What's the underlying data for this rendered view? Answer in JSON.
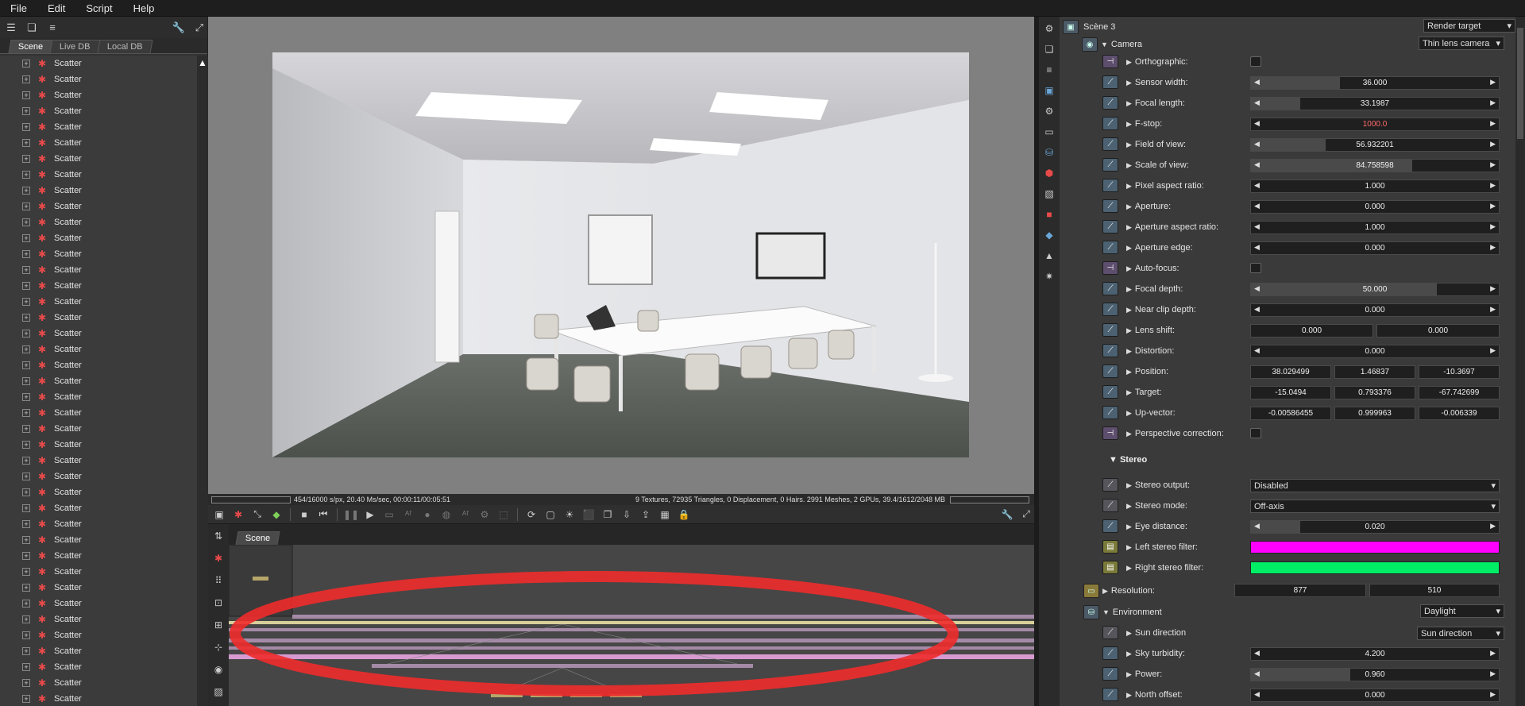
{
  "menu": [
    "File",
    "Edit",
    "Script",
    "Help"
  ],
  "left_tabs": [
    "Scene",
    "Live DB",
    "Local DB"
  ],
  "scene_items": [
    "Scatter",
    "Scatter",
    "Scatter",
    "Scatter",
    "Scatter",
    "Scatter",
    "Scatter",
    "Scatter",
    "Scatter",
    "Scatter",
    "Scatter",
    "Scatter",
    "Scatter",
    "Scatter",
    "Scatter",
    "Scatter",
    "Scatter",
    "Scatter",
    "Scatter",
    "Scatter",
    "Scatter",
    "Scatter",
    "Scatter",
    "Scatter",
    "Scatter",
    "Scatter",
    "Scatter",
    "Scatter",
    "Scatter",
    "Scatter",
    "Scatter",
    "Scatter",
    "Scatter",
    "Scatter",
    "Scatter",
    "Scatter",
    "Scatter",
    "Scatter",
    "Scatter",
    "Scatter",
    "Scatter"
  ],
  "status": {
    "left": "454/16000 s/px, 20.40 Ms/sec, 00:00:11/00:05:51",
    "right": "9 Textures, 72935 Triangles, 0 Displacement, 0 Hairs. 2991 Meshes, 2 GPUs, 39.4/1612/2048 MB"
  },
  "graph_tab": "Scene",
  "inspector": {
    "root_title": "Scène 3",
    "root_dd": "Render target",
    "camera_title": "Camera",
    "camera_dd": "Thin lens camera",
    "props": [
      {
        "label": "Orthographic:",
        "kind": "check"
      },
      {
        "label": "Sensor width:",
        "kind": "slider",
        "value": "36.000",
        "fill": 0.36
      },
      {
        "label": "Focal length:",
        "kind": "slider",
        "value": "33.1987",
        "fill": 0.2
      },
      {
        "label": "F-stop:",
        "kind": "slider",
        "value": "1000.0",
        "fill": 0.0,
        "red": true
      },
      {
        "label": "Field of view:",
        "kind": "slider",
        "value": "56.932201",
        "fill": 0.3
      },
      {
        "label": "Scale of view:",
        "kind": "slider",
        "value": "84.758598",
        "fill": 0.65
      },
      {
        "label": "Pixel aspect ratio:",
        "kind": "slider",
        "value": "1.000",
        "fill": 0.0
      },
      {
        "label": "Aperture:",
        "kind": "slider",
        "value": "0.000",
        "fill": 0.0
      },
      {
        "label": "Aperture aspect ratio:",
        "kind": "slider",
        "value": "1.000",
        "fill": 0.0
      },
      {
        "label": "Aperture edge:",
        "kind": "slider",
        "value": "0.000",
        "fill": 0.0
      },
      {
        "label": "Auto-focus:",
        "kind": "check"
      },
      {
        "label": "Focal depth:",
        "kind": "slider",
        "value": "50.000",
        "fill": 0.75
      },
      {
        "label": "Near clip depth:",
        "kind": "slider",
        "value": "0.000",
        "fill": 0.0
      },
      {
        "label": "Lens shift:",
        "kind": "two",
        "values": [
          "0.000",
          "0.000"
        ]
      },
      {
        "label": "Distortion:",
        "kind": "slider",
        "value": "0.000",
        "fill": 0.0
      },
      {
        "label": "Position:",
        "kind": "three",
        "values": [
          "38.029499",
          "1.46837",
          "-10.3697"
        ]
      },
      {
        "label": "Target:",
        "kind": "three",
        "values": [
          "-15.0494",
          "0.793376",
          "-67.742699"
        ]
      },
      {
        "label": "Up-vector:",
        "kind": "three",
        "values": [
          "-0.00586455",
          "0.999963",
          "-0.006339"
        ]
      },
      {
        "label": "Perspective correction:",
        "kind": "check"
      }
    ],
    "stereo_title": "Stereo",
    "stereo_props": [
      {
        "label": "Stereo output:",
        "kind": "dd",
        "value": "Disabled"
      },
      {
        "label": "Stereo mode:",
        "kind": "dd",
        "value": "Off-axis"
      },
      {
        "label": "Eye distance:",
        "kind": "slider",
        "value": "0.020",
        "fill": 0.2
      },
      {
        "label": "Left stereo filter:",
        "kind": "color",
        "color": "#ff00ff"
      },
      {
        "label": "Right stereo filter:",
        "kind": "color",
        "color": "#00ee66"
      }
    ],
    "resolution_label": "Resolution:",
    "resolution": [
      "877",
      "510"
    ],
    "env_title": "Environment",
    "env_dd": "Daylight",
    "env_props": [
      {
        "label": "Sun direction",
        "kind": "dd",
        "value": "Sun direction"
      },
      {
        "label": "Sky turbidity:",
        "kind": "slider",
        "value": "4.200",
        "fill": 0.0
      },
      {
        "label": "Power:",
        "kind": "slider",
        "value": "0.960",
        "fill": 0.4
      },
      {
        "label": "North offset:",
        "kind": "slider",
        "value": "0.000",
        "fill": 0.0
      }
    ]
  }
}
